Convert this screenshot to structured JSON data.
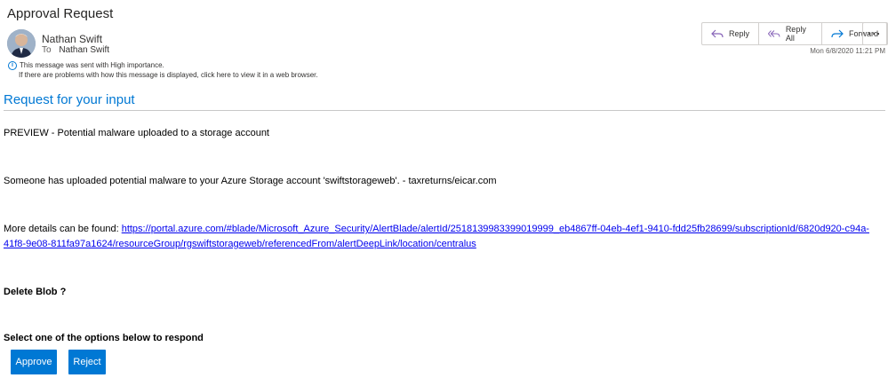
{
  "header": {
    "subject": "Approval Request",
    "sender_name": "Nathan Swift",
    "to_label": "To",
    "recipient": "Nathan Swift",
    "importance_note": "This message was sent with High importance.",
    "display_note": "If there are problems with how this message is displayed, click here to view it in a web browser.",
    "timestamp": "Mon 6/8/2020 11:21 PM"
  },
  "toolbar": {
    "reply_label": "Reply",
    "reply_all_label": "Reply All",
    "forward_label": "Forward",
    "more_label": "···"
  },
  "body": {
    "heading": "Request for your input",
    "preview_line": "PREVIEW - Potential malware uploaded to a storage account",
    "description": "Someone has uploaded potential malware to your Azure Storage account 'swiftstorageweb'. - taxreturns/eicar.com",
    "details_prefix": "More details can be found: ",
    "details_link": "https://portal.azure.com/#blade/Microsoft_Azure_Security/AlertBlade/alertId/2518139983399019999_eb4867ff-04eb-4ef1-9410-fdd25fb28699/subscriptionId/6820d920-c94a-41f8-9e08-811fa97a1624/resourceGroup/rgswiftstorageweb/referencedFrom/alertDeepLink/location/centralus",
    "question": "Delete Blob ?",
    "instruction": "Select one of the options below to respond"
  },
  "actions": {
    "approve_label": "Approve",
    "reject_label": "Reject"
  },
  "colors": {
    "accent": "#0078d4",
    "link": "#0000ee"
  }
}
